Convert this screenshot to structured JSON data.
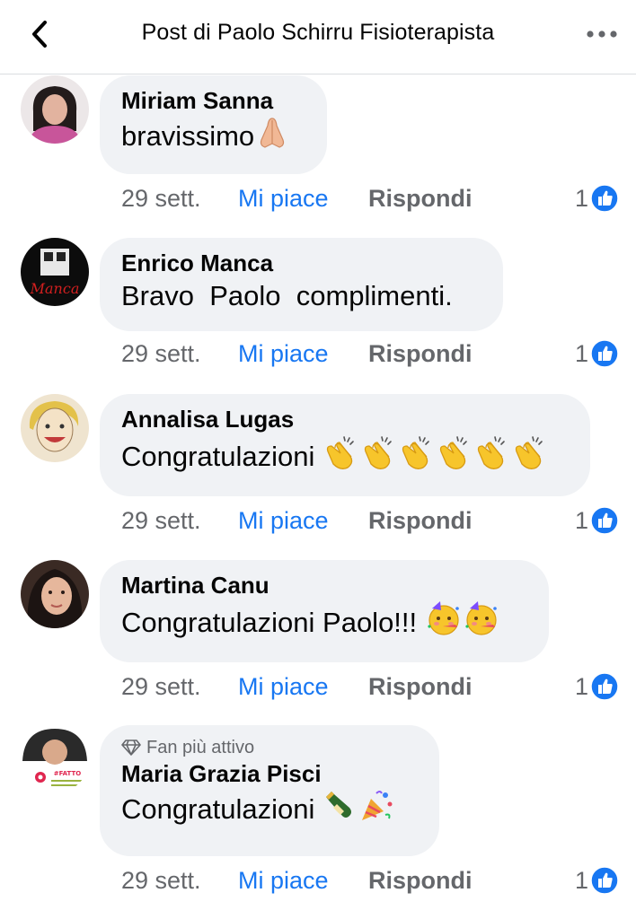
{
  "header": {
    "title": "Post di Paolo Schirru Fisioterapista",
    "back_icon": "chevron-left-icon",
    "more_icon": "more-horizontal-icon"
  },
  "colors": {
    "accent": "#1877f2",
    "bubble": "#f0f2f5",
    "secondary_text": "#65676b"
  },
  "actions": {
    "like_label": "Mi piace",
    "reply_label": "Rispondi"
  },
  "comments": [
    {
      "author": "Miriam Sanna",
      "text": "bravissimo",
      "emojis": [
        "folded-hands"
      ],
      "time": "29 sett.",
      "reactions": "1"
    },
    {
      "author": "Enrico Manca",
      "text": "Bravo  Paolo  complimenti.",
      "emojis": [],
      "time": "29 sett.",
      "reactions": "1"
    },
    {
      "author": "Annalisa Lugas",
      "text": "Congratulazioni ",
      "emojis": [
        "clapping-hands",
        "clapping-hands",
        "clapping-hands",
        "clapping-hands",
        "clapping-hands",
        "clapping-hands"
      ],
      "time": "29 sett.",
      "reactions": "1"
    },
    {
      "author": "Martina Canu",
      "text": "Congratulazioni Paolo!!! ",
      "emojis": [
        "partying-face",
        "partying-face"
      ],
      "time": "29 sett.",
      "reactions": "1"
    },
    {
      "author": "Maria Grazia Pisci",
      "badge": "Fan più attivo",
      "text": "Congratulazioni ",
      "emojis": [
        "champagne-bottle",
        "party-popper"
      ],
      "time": "29 sett.",
      "reactions": "1",
      "avatar_text": "#FATTO"
    }
  ]
}
